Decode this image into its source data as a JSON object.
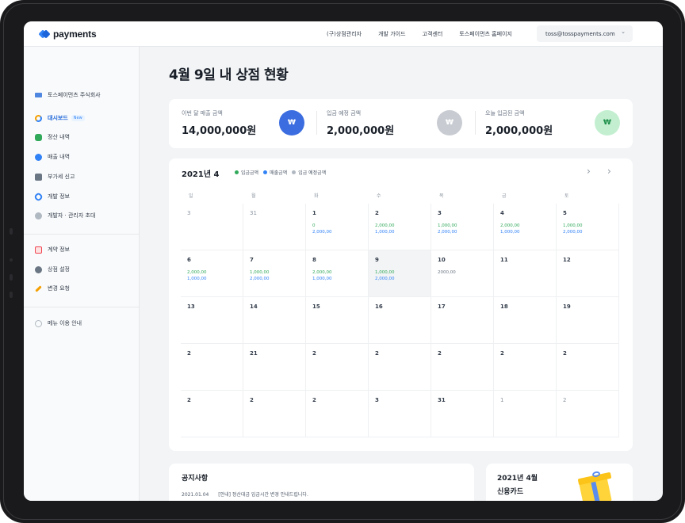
{
  "topbar": {
    "logo": "payments",
    "nav": [
      "(구)상점관리자",
      "개발 가이드",
      "고객센터",
      "토스페이먼츠 홈페이지"
    ],
    "account": "toss@tosspayments.com"
  },
  "sidebar": {
    "company": "토스페이먼츠 주식회사",
    "items": [
      {
        "label": "대시보드",
        "badge": "New"
      },
      {
        "label": "정산 내역"
      },
      {
        "label": "매출 내역"
      },
      {
        "label": "부가세 신고"
      },
      {
        "label": "개발 정보"
      },
      {
        "label": "개발자 · 관리자 초대"
      }
    ],
    "items2": [
      {
        "label": "계약 정보"
      },
      {
        "label": "상점 설정"
      },
      {
        "label": "변경 요청"
      }
    ],
    "help": "메뉴 이용 안내"
  },
  "page": {
    "title": "4월 9일 내 상점 현황"
  },
  "summary": [
    {
      "label": "이번 달 매출 금액",
      "value": "14,000,000원",
      "icon": "won-coin-icon",
      "color": "#3b6de0"
    },
    {
      "label": "입금 예정 금액",
      "value": "2,000,000원",
      "icon": "won-pouch-icon",
      "color": "#c8ccd2"
    },
    {
      "label": "오늘 입금된 금액",
      "value": "2,000,000원",
      "icon": "money-bag-icon",
      "color": "#c3efd0"
    }
  ],
  "calendar": {
    "title": "2021년 4",
    "legend": [
      {
        "label": "입금금액",
        "color": "#31a95a"
      },
      {
        "label": "매출금액",
        "color": "#3182f6"
      },
      {
        "label": "입금 예정금액",
        "color": "#b0b8c1"
      }
    ],
    "weekdays": [
      "일",
      "월",
      "화",
      "수",
      "목",
      "금",
      "토"
    ],
    "weeks": [
      [
        {
          "day": "3",
          "muted": true
        },
        {
          "day": "31",
          "muted": true
        },
        {
          "day": "1",
          "a": "0",
          "b": "2,000,00"
        },
        {
          "day": "2",
          "a": "2,000,00",
          "b": "1,000,00"
        },
        {
          "day": "3",
          "a": "1,000,00",
          "b": "2,000,00"
        },
        {
          "day": "4",
          "a": "2,000,00",
          "b": "1,000,00"
        },
        {
          "day": "5",
          "a": "1,000,00",
          "b": "2,000,00"
        }
      ],
      [
        {
          "day": "6",
          "a": "2,000,00",
          "b": "1,000,00"
        },
        {
          "day": "7",
          "a": "1,000,00",
          "b": "2,000,00"
        },
        {
          "day": "8",
          "a": "2,000,00",
          "b": "1,000,00"
        },
        {
          "day": "9",
          "a": "1,000,00",
          "b": "2,000,00",
          "today": true
        },
        {
          "day": "10",
          "g": "2000,00"
        },
        {
          "day": "11"
        },
        {
          "day": "12"
        }
      ],
      [
        {
          "day": "13"
        },
        {
          "day": "14"
        },
        {
          "day": "15"
        },
        {
          "day": "16"
        },
        {
          "day": "17"
        },
        {
          "day": "18"
        },
        {
          "day": "19"
        }
      ],
      [
        {
          "day": "2"
        },
        {
          "day": "21"
        },
        {
          "day": "2"
        },
        {
          "day": "2"
        },
        {
          "day": "2"
        },
        {
          "day": "2"
        },
        {
          "day": "2"
        }
      ],
      [
        {
          "day": "2"
        },
        {
          "day": "2"
        },
        {
          "day": "2"
        },
        {
          "day": "3"
        },
        {
          "day": "31"
        },
        {
          "day": "1",
          "muted": true
        },
        {
          "day": "2",
          "muted": true
        }
      ]
    ]
  },
  "notice": {
    "title": "공지사항",
    "date": "2021.01.04",
    "text": "[안내] 정산대금 입금시간 변경 안내드립니다."
  },
  "promo": {
    "line1": "2021년 4월",
    "line2": "신용카드"
  }
}
